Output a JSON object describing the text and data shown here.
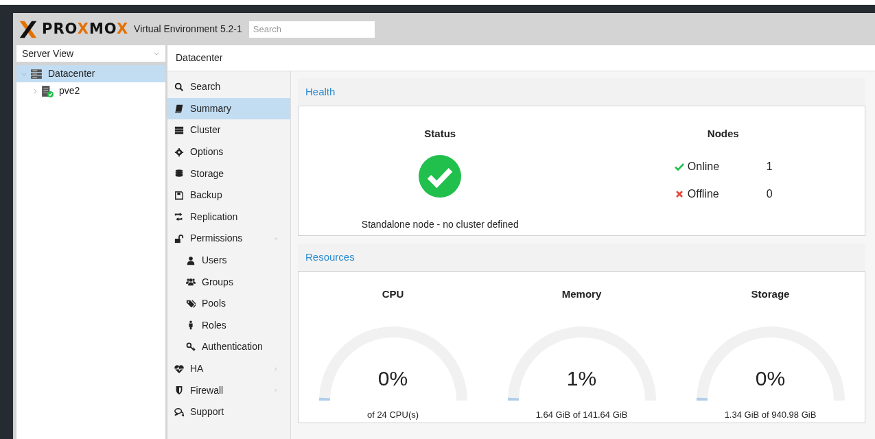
{
  "header": {
    "logo": [
      {
        "text": "PRO",
        "accent": false
      },
      {
        "text": "X",
        "accent": true
      },
      {
        "text": "MO",
        "accent": false
      },
      {
        "text": "X",
        "accent": true
      }
    ],
    "product": "Virtual Environment 5.2-1",
    "search": {
      "placeholder": "Search"
    }
  },
  "view_selector": "Server View",
  "tree": [
    {
      "label": "Datacenter",
      "selected": true,
      "expanded": true,
      "children": [
        {
          "label": "pve2",
          "selected": false,
          "expanded": false
        }
      ]
    }
  ],
  "breadcrumb": "Datacenter",
  "nav": [
    {
      "label": "Search",
      "selected": false
    },
    {
      "label": "Summary",
      "selected": true
    },
    {
      "label": "Cluster",
      "selected": false
    },
    {
      "label": "Options",
      "selected": false
    },
    {
      "label": "Storage",
      "selected": false
    },
    {
      "label": "Backup",
      "selected": false
    },
    {
      "label": "Replication",
      "selected": false
    },
    {
      "label": "Permissions",
      "selected": false,
      "expanded": true,
      "children": [
        {
          "label": "Users",
          "selected": false
        },
        {
          "label": "Groups",
          "selected": false
        },
        {
          "label": "Pools",
          "selected": false
        },
        {
          "label": "Roles",
          "selected": false
        },
        {
          "label": "Authentication",
          "selected": false
        }
      ]
    },
    {
      "label": "HA",
      "selected": false,
      "expanded": false
    },
    {
      "label": "Firewall",
      "selected": false,
      "expanded": false
    },
    {
      "label": "Support",
      "selected": false
    }
  ],
  "health": {
    "title": "Health",
    "status": {
      "heading": "Status",
      "ok": true,
      "text": "Standalone node - no cluster defined"
    },
    "nodes": {
      "heading": "Nodes",
      "rows": [
        {
          "label": "Online",
          "value": "1",
          "kind": "ok"
        },
        {
          "label": "Offline",
          "value": "0",
          "kind": "error"
        }
      ]
    }
  },
  "resources": {
    "title": "Resources",
    "gauges": [
      {
        "heading": "CPU",
        "reading": "0%",
        "detail": "of 24 CPU(s)"
      },
      {
        "heading": "Memory",
        "reading": "1%",
        "detail": "1.64 GiB of 141.64 GiB"
      },
      {
        "heading": "Storage",
        "reading": "0%",
        "detail": "1.34 GiB of 940.98 GiB"
      }
    ]
  }
}
